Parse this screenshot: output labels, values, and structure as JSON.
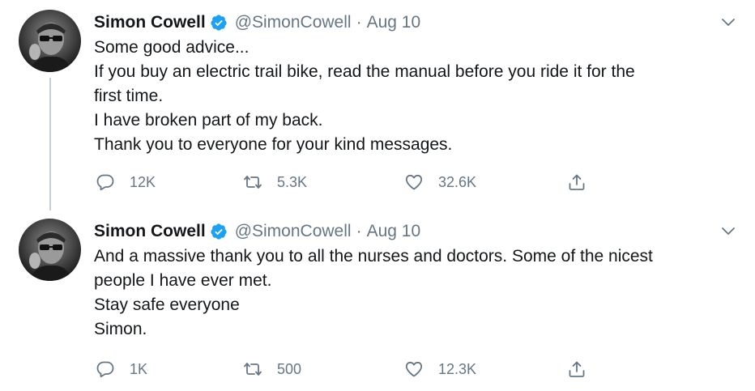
{
  "tweets": [
    {
      "author_name": "Simon Cowell",
      "handle": "@SimonCowell",
      "separator": "·",
      "date": "Aug 10",
      "verified": true,
      "lines": [
        "Some good advice...",
        "If you buy an electric trail bike, read the manual before you ride it for the",
        "first time.",
        "I have broken part of my back.",
        "Thank you to everyone for your kind messages."
      ],
      "replies": "12K",
      "retweets": "5.3K",
      "likes": "32.6K"
    },
    {
      "author_name": "Simon Cowell",
      "handle": "@SimonCowell",
      "separator": "·",
      "date": "Aug 10",
      "verified": true,
      "lines": [
        "And a massive thank you to all the nurses and doctors. Some of the nicest",
        "people I have ever met.",
        "Stay safe everyone",
        "Simon."
      ],
      "replies": "1K",
      "retweets": "500",
      "likes": "12.3K"
    }
  ],
  "colors": {
    "text": "#14171a",
    "secondary": "#657786",
    "verified": "#1da1f2",
    "thread_line": "#c4cfd6"
  },
  "icons": {
    "reply": "reply-icon",
    "retweet": "retweet-icon",
    "like": "heart-icon",
    "share": "share-icon",
    "menu": "chevron-down-icon",
    "verified": "verified-badge-icon"
  }
}
